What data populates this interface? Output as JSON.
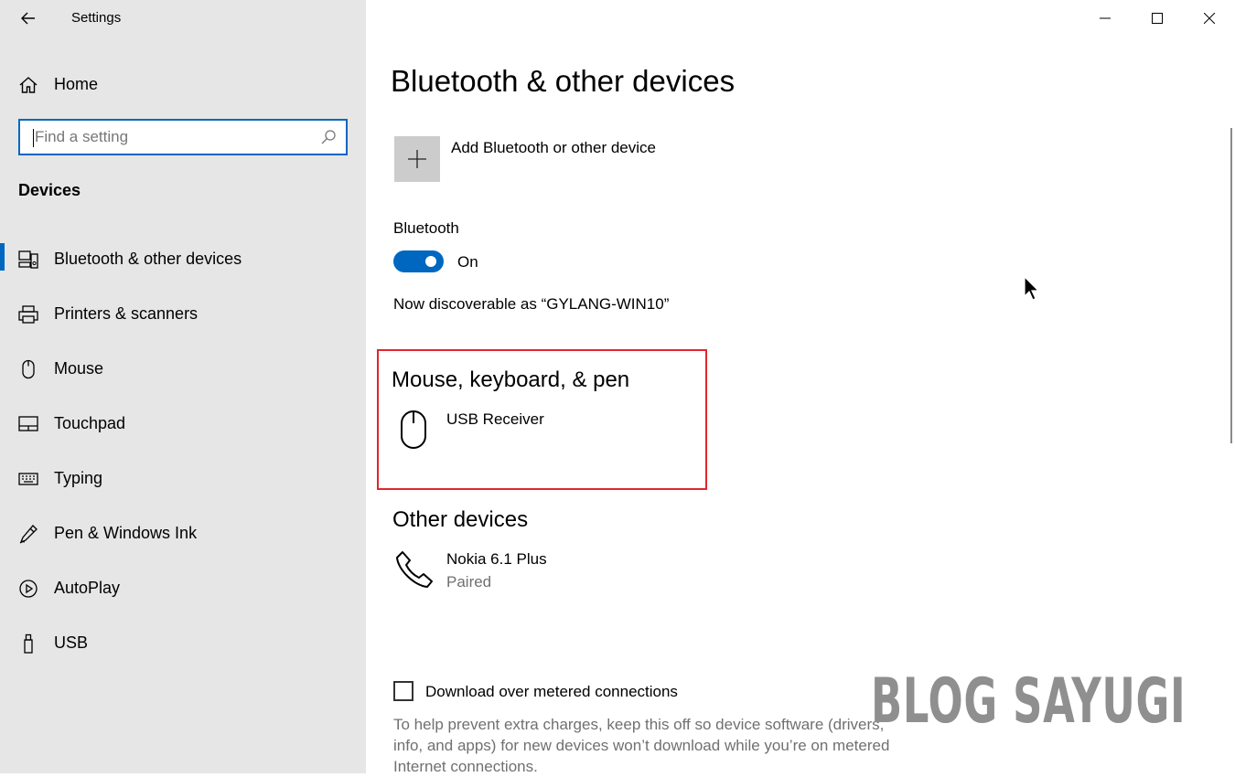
{
  "window": {
    "title": "Settings",
    "controls": [
      "minimize-icon",
      "maximize-icon",
      "close-icon"
    ]
  },
  "sidebar": {
    "home_label": "Home",
    "search_placeholder": "Find a setting",
    "section_title": "Devices",
    "items": [
      {
        "label": "Bluetooth & other devices",
        "icon": "bluetooth-devices-icon",
        "active": true
      },
      {
        "label": "Printers & scanners",
        "icon": "printer-icon"
      },
      {
        "label": "Mouse",
        "icon": "mouse-icon"
      },
      {
        "label": "Touchpad",
        "icon": "touchpad-icon"
      },
      {
        "label": "Typing",
        "icon": "keyboard-icon"
      },
      {
        "label": "Pen & Windows Ink",
        "icon": "pen-icon"
      },
      {
        "label": "AutoPlay",
        "icon": "autoplay-icon"
      },
      {
        "label": "USB",
        "icon": "usb-icon"
      }
    ]
  },
  "main": {
    "title": "Bluetooth & other devices",
    "add_device_label": "Add Bluetooth or other device",
    "bluetooth_label": "Bluetooth",
    "bluetooth_state": "On",
    "discoverable_text": "Now discoverable as “GYLANG-WIN10”",
    "mouse_section": {
      "title": "Mouse, keyboard, & pen",
      "devices": [
        {
          "name": "USB Receiver",
          "icon": "mouse-icon"
        }
      ]
    },
    "other_section": {
      "title": "Other devices",
      "devices": [
        {
          "name": "Nokia 6.1 Plus",
          "status": "Paired",
          "icon": "phone-icon"
        }
      ]
    },
    "metered_label": "Download over metered connections",
    "metered_checked": false,
    "metered_description": "To help prevent extra charges, keep this off so device software (drivers, info, and apps) for new devices won’t download while you’re on metered Internet connections."
  },
  "watermark": "BLOG SAYUGI",
  "colors": {
    "accent": "#0067c0",
    "sidebar_bg": "#e6e6e6",
    "highlight": "#e0262f",
    "secondary_text": "#707070"
  }
}
